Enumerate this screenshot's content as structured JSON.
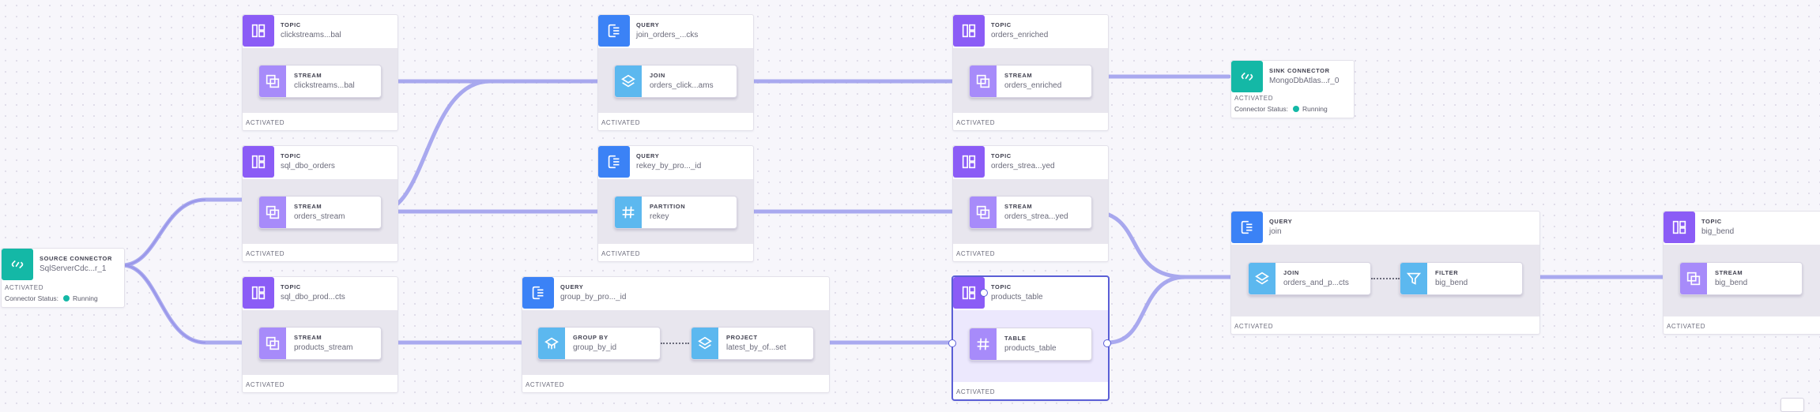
{
  "colors": {
    "edge": "#9b9bec",
    "topic": "#8b5cf6",
    "query": "#3b82f6",
    "connector": "#14b8a6",
    "selected": "#5b5fd6"
  },
  "source_connector": {
    "type": "SOURCE CONNECTOR",
    "name": "SqlServerCdc...r_1",
    "activated": "ACTIVATED",
    "status_label": "Connector Status:",
    "status_value": "Running",
    "icon": "connector-icon"
  },
  "topics": {
    "clickstreams": {
      "type": "TOPIC",
      "name": "clickstreams...bal",
      "stream_type": "STREAM",
      "stream_name": "clickstreams...bal",
      "footer": "ACTIVATED"
    },
    "sql_dbo_orders": {
      "type": "TOPIC",
      "name": "sql_dbo_orders",
      "stream_type": "STREAM",
      "stream_name": "orders_stream",
      "footer": "ACTIVATED"
    },
    "sql_dbo_products": {
      "type": "TOPIC",
      "name": "sql_dbo_prod...cts",
      "stream_type": "STREAM",
      "stream_name": "products_stream",
      "footer": "ACTIVATED"
    },
    "orders_enriched": {
      "type": "TOPIC",
      "name": "orders_enriched",
      "stream_type": "STREAM",
      "stream_name": "orders_enriched",
      "footer": "ACTIVATED"
    },
    "orders_stream_keyed": {
      "type": "TOPIC",
      "name": "orders_strea...yed",
      "stream_type": "STREAM",
      "stream_name": "orders_strea...yed",
      "footer": "ACTIVATED"
    },
    "products_table": {
      "type": "TOPIC",
      "name": "products_table",
      "stream_type": "TABLE",
      "stream_name": "products_table",
      "footer": "ACTIVATED"
    },
    "big_bend": {
      "type": "TOPIC",
      "name": "big_bend",
      "stream_type": "STREAM",
      "stream_name": "big_bend",
      "footer": "ACTIVATED"
    }
  },
  "queries": {
    "join_orders": {
      "type": "QUERY",
      "name": "join_orders_...cks",
      "op_type": "JOIN",
      "op_name": "orders_click...ams",
      "footer": "ACTIVATED"
    },
    "rekey": {
      "type": "QUERY",
      "name": "rekey_by_pro..._id",
      "op_type": "PARTITION",
      "op_name": "rekey",
      "footer": "ACTIVATED"
    },
    "group_by": {
      "type": "QUERY",
      "name": "group_by_pro..._id",
      "op1_type": "GROUP BY",
      "op1_name": "group_by_id",
      "op2_type": "PROJECT",
      "op2_name": "latest_by_of...set",
      "footer": "ACTIVATED"
    },
    "join": {
      "type": "QUERY",
      "name": "join",
      "op1_type": "JOIN",
      "op1_name": "orders_and_p...cts",
      "op2_type": "FILTER",
      "op2_name": "big_bend",
      "footer": "ACTIVATED"
    }
  },
  "sink_connector": {
    "type": "SINK CONNECTOR",
    "name": "MongoDbAtlas...r_0",
    "activated": "ACTIVATED",
    "status_label": "Connector Status:",
    "status_value": "Running",
    "icon": "connector-icon"
  }
}
